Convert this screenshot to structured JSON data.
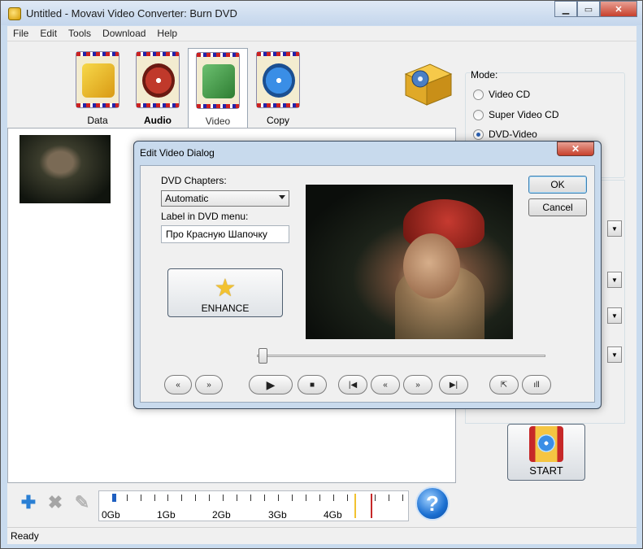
{
  "window": {
    "title": "Untitled - Movavi Video Converter: Burn DVD"
  },
  "menu": [
    "File",
    "Edit",
    "Tools",
    "Download",
    "Help"
  ],
  "tabs": [
    {
      "label": "Data",
      "color": "#f0c030"
    },
    {
      "label": "Audio",
      "color": "#c0392b"
    },
    {
      "label": "Video",
      "color": "#4caf50"
    },
    {
      "label": "Copy",
      "color": "#3a8ee6"
    }
  ],
  "mode": {
    "label": "Mode:",
    "options": [
      "Video CD",
      "Super Video CD",
      "DVD-Video"
    ],
    "selected": "DVD-Video"
  },
  "ruler": {
    "labels": [
      "0Gb",
      "1Gb",
      "2Gb",
      "3Gb",
      "4Gb"
    ]
  },
  "start_label": "START",
  "status": "Ready",
  "dialog": {
    "title": "Edit Video Dialog",
    "close": "✕",
    "chapters_label": "DVD Chapters:",
    "chapters_value": "Automatic",
    "menu_label": "Label in DVD menu:",
    "menu_value": "Про Красную Шапочку",
    "enhance_label": "ENHANCE",
    "ok": "OK",
    "cancel": "Cancel"
  },
  "icons": {
    "add": "✚",
    "remove": "✖",
    "edit": "✎",
    "help": "?",
    "minimize": "▁",
    "maximize": "▭",
    "close": "✕"
  },
  "player": {
    "controls": [
      "«",
      "»",
      "▶",
      "■",
      "|◀",
      "«",
      "»",
      "▶|",
      "⇱",
      "ıll"
    ]
  }
}
